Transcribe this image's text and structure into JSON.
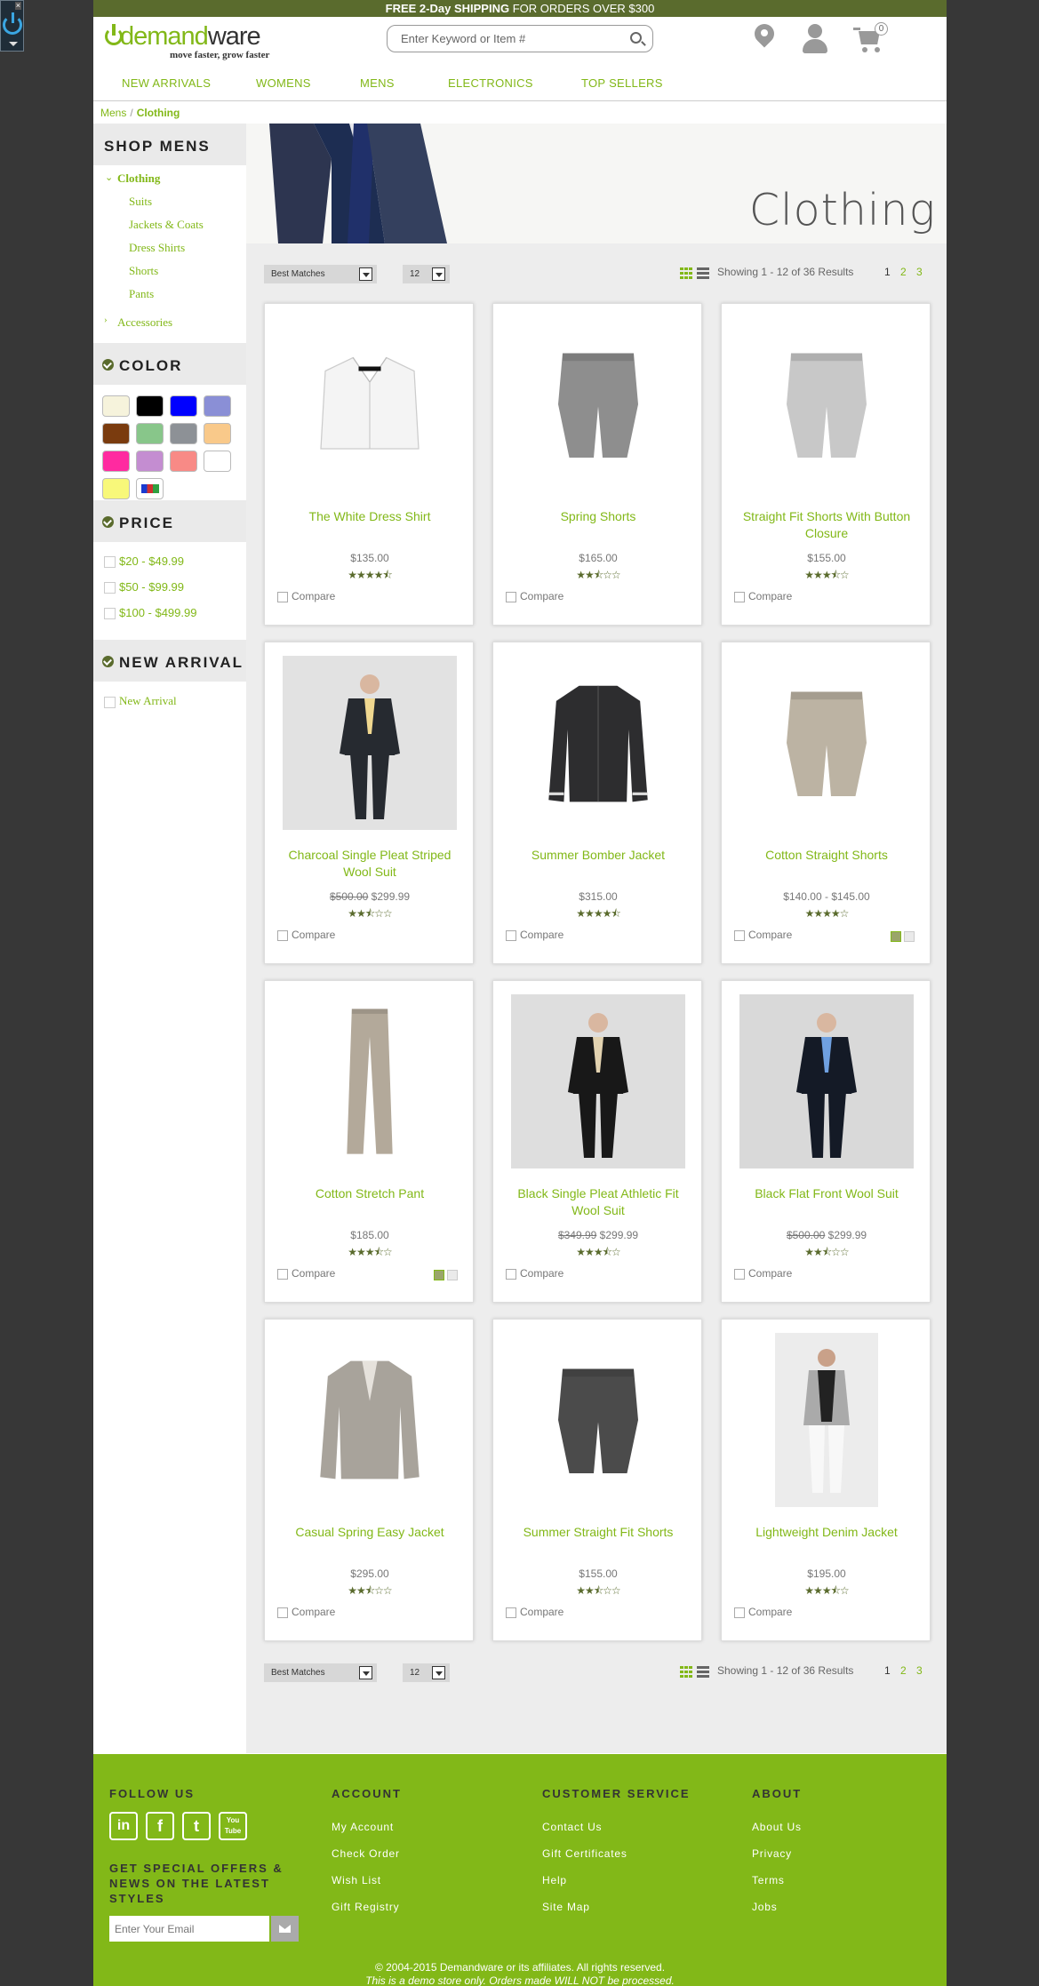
{
  "promo": {
    "bold": "FREE 2-Day SHIPPING",
    "rest": " FOR ORDERS OVER $300"
  },
  "brand": {
    "name_a": "demand",
    "name_b": "ware",
    "tagline": "move faster, grow faster"
  },
  "search": {
    "placeholder": "Enter Keyword or Item #"
  },
  "cart": {
    "count": "0"
  },
  "nav": [
    "NEW ARRIVALS",
    "WOMENS",
    "MENS",
    "ELECTRONICS",
    "TOP SELLERS"
  ],
  "breadcrumb": {
    "parent": "Mens",
    "sep": "/",
    "current": "Clothing"
  },
  "sidebar": {
    "title": "SHOP MENS",
    "category": "Clothing",
    "subcategories": [
      "Suits",
      "Jackets & Coats",
      "Dress Shirts",
      "Shorts",
      "Pants"
    ],
    "accessories": "Accessories",
    "color_title": "COLOR",
    "colors": [
      "#f6f3dc",
      "#000000",
      "#0000ff",
      "#8a8fd6",
      "#7a3b0e",
      "#88c68a",
      "#8d9196",
      "#f9c98a",
      "#ff2aa0",
      "#c48dd1",
      "#f88a86",
      "#ffffff",
      "#f8f87a",
      "multi"
    ],
    "price_title": "PRICE",
    "prices": [
      "$20 - $49.99",
      "$50 - $99.99",
      "$100 - $499.99"
    ],
    "new_arrival_title": "NEW ARRIVAL",
    "new_arrival": "New Arrival"
  },
  "hero": {
    "title": "Clothing"
  },
  "toolbar": {
    "sort": "Best Matches",
    "per_page": "12",
    "results": "Showing 1 - 12 of 36 Results",
    "pages": [
      "1",
      "2",
      "3"
    ]
  },
  "products": [
    {
      "name": "The White Dress Shirt",
      "price": "$135.00",
      "old": "",
      "stars": "★★★★⯪",
      "rating": 4.5,
      "compare": "Compare",
      "img": "shirt"
    },
    {
      "name": "Spring Shorts",
      "price": "$165.00",
      "old": "",
      "stars": "★★⯪☆☆",
      "rating": 2.5,
      "compare": "Compare",
      "img": "shorts-grey"
    },
    {
      "name": "Straight Fit Shorts With Button Closure",
      "price": "$155.00",
      "old": "",
      "stars": "★★★⯪☆",
      "rating": 3.5,
      "compare": "Compare",
      "img": "shorts-light"
    },
    {
      "name": "Charcoal Single Pleat Striped Wool Suit",
      "price": "$299.99",
      "old": "$500.00",
      "stars": "★★⯪☆☆",
      "rating": 2.5,
      "compare": "Compare",
      "img": "suit-grey"
    },
    {
      "name": "Summer Bomber Jacket",
      "price": "$315.00",
      "old": "",
      "stars": "★★★★⯪",
      "rating": 4.5,
      "compare": "Compare",
      "img": "bomber"
    },
    {
      "name": "Cotton Straight Shorts",
      "price": "$140.00 - $145.00",
      "old": "",
      "stars": "★★★★☆",
      "rating": 4,
      "compare": "Compare",
      "img": "shorts-khaki",
      "swatches": true
    },
    {
      "name": "Cotton Stretch Pant",
      "price": "$185.00",
      "old": "",
      "stars": "★★★⯪☆",
      "rating": 3.5,
      "compare": "Compare",
      "img": "pant",
      "swatches": true
    },
    {
      "name": "Black Single Pleat Athletic Fit Wool Suit",
      "price": "$299.99",
      "old": "$349.99",
      "stars": "★★★⯪☆",
      "rating": 3.5,
      "compare": "Compare",
      "img": "suit-black"
    },
    {
      "name": "Black Flat Front Wool Suit",
      "price": "$299.99",
      "old": "$500.00",
      "stars": "★★⯪☆☆",
      "rating": 2.5,
      "compare": "Compare",
      "img": "suit-blue"
    },
    {
      "name": "Casual Spring Easy Jacket",
      "price": "$295.00",
      "old": "",
      "stars": "★★⯪☆☆",
      "rating": 2.5,
      "compare": "Compare",
      "img": "jacket"
    },
    {
      "name": "Summer Straight Fit Shorts",
      "price": "$155.00",
      "old": "",
      "stars": "★★⯪☆☆",
      "rating": 2.5,
      "compare": "Compare",
      "img": "shorts-dark"
    },
    {
      "name": "Lightweight Denim Jacket",
      "price": "$195.00",
      "old": "",
      "stars": "★★★⯪☆",
      "rating": 3.5,
      "compare": "Compare",
      "img": "model-white"
    }
  ],
  "footer": {
    "follow": "FOLLOW US",
    "social": [
      "in",
      "f",
      "t",
      "You Tube"
    ],
    "offer": "GET SPECIAL OFFERS & NEWS ON THE LATEST STYLES",
    "email_placeholder": "Enter Your Email",
    "account": {
      "title": "ACCOUNT",
      "links": [
        "My Account",
        "Check Order",
        "Wish List",
        "Gift Registry"
      ]
    },
    "service": {
      "title": "CUSTOMER SERVICE",
      "links": [
        "Contact Us",
        "Gift Certificates",
        "Help",
        "Site Map"
      ]
    },
    "about": {
      "title": "ABOUT",
      "links": [
        "About Us",
        "Privacy",
        "Terms",
        "Jobs"
      ]
    },
    "copyright": "© 2004-2015 Demandware or its affiliates. All rights reserved.",
    "demo": "This is a demo store only. Orders made WILL NOT be processed."
  }
}
